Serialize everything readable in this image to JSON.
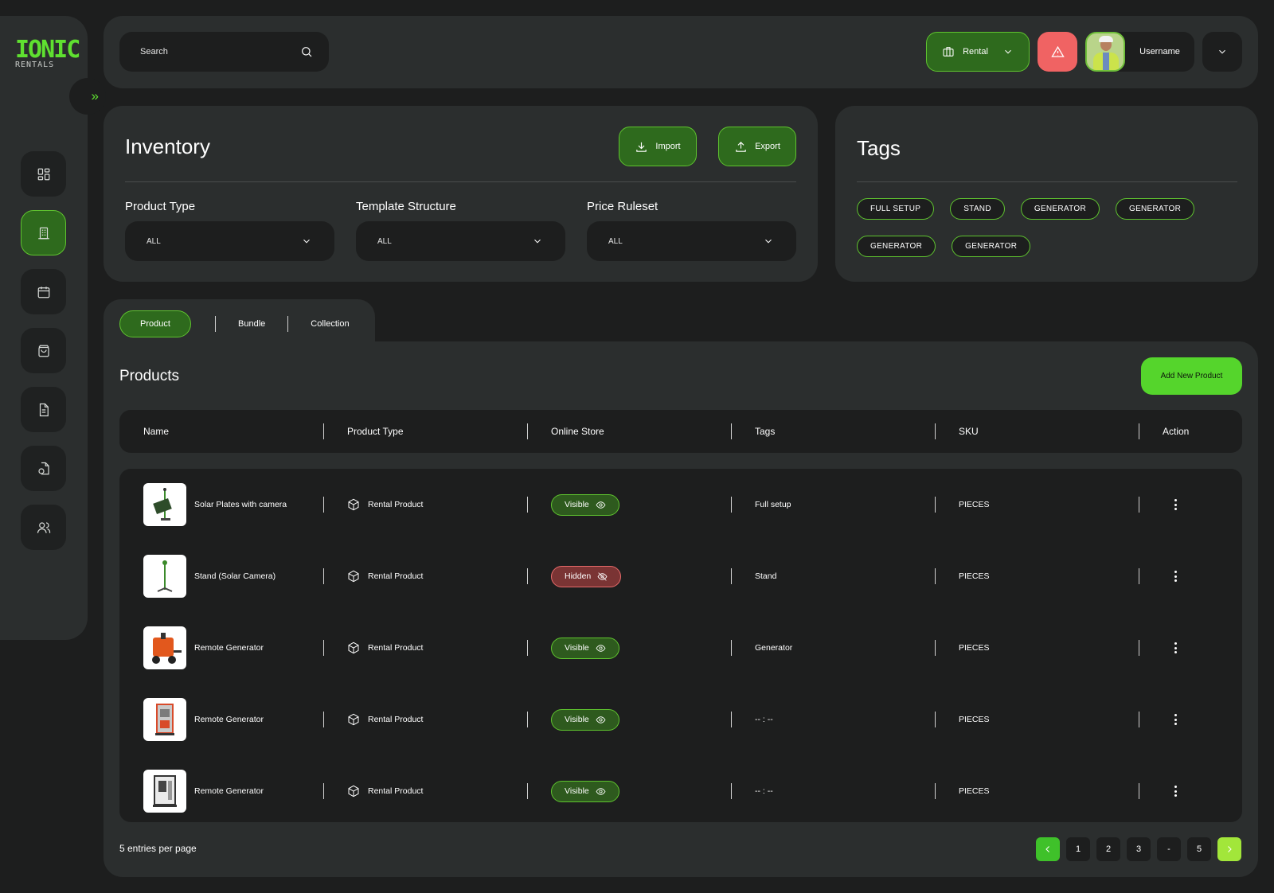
{
  "brand": {
    "logo_line1": "IONIC",
    "logo_line2": "RENTALS"
  },
  "colors": {
    "accent": "#5fc42f",
    "accent_bright": "#55d52c",
    "danger": "#f06363",
    "panel": "#2b2e2e",
    "background": "#1d1e1e"
  },
  "sidebar": {
    "toggle_icon": "double-chevron-right-icon",
    "items": [
      {
        "icon": "dashboard-grid-icon",
        "active": false
      },
      {
        "icon": "inventory-building-icon",
        "active": true
      },
      {
        "icon": "calendar-icon",
        "active": false
      },
      {
        "icon": "shopping-bag-icon",
        "active": false
      },
      {
        "icon": "document-icon",
        "active": false
      },
      {
        "icon": "file-settings-icon",
        "active": false
      },
      {
        "icon": "users-icon",
        "active": false
      }
    ]
  },
  "topbar": {
    "search": {
      "placeholder": "Search",
      "value": ""
    },
    "mode_label": "Rental",
    "username": "Username"
  },
  "inventory": {
    "title": "Inventory",
    "import_label": "Import",
    "export_label": "Export",
    "filters": [
      {
        "label": "Product Type",
        "value": "ALL"
      },
      {
        "label": "Template Structure",
        "value": "ALL"
      },
      {
        "label": "Price Ruleset",
        "value": "ALL"
      }
    ]
  },
  "tags_panel": {
    "title": "Tags",
    "tags": [
      "FULL SETUP",
      "STAND",
      "GENERATOR",
      "GENERATOR",
      "GENERATOR",
      "GENERATOR"
    ]
  },
  "tabs": [
    {
      "label": "Product",
      "active": true
    },
    {
      "label": "Bundle",
      "active": false
    },
    {
      "label": "Collection",
      "active": false
    }
  ],
  "products": {
    "title": "Products",
    "add_label": "Add New Product",
    "columns": [
      "Name",
      "Product Type",
      "Online Store",
      "Tags",
      "SKU",
      "Action"
    ],
    "rows": [
      {
        "name": "Solar Plates with camera",
        "type": "Rental Product",
        "status": "Visible",
        "tags": "Full setup",
        "sku": "PIECES",
        "image": "solar-plates-image"
      },
      {
        "name": "Stand (Solar Camera)",
        "type": "Rental Product",
        "status": "Hidden",
        "tags": "Stand",
        "sku": "PIECES",
        "image": "stand-image"
      },
      {
        "name": "Remote Generator",
        "type": "Rental Product",
        "status": "Visible",
        "tags": "Generator",
        "sku": "PIECES",
        "image": "orange-generator-image"
      },
      {
        "name": "Remote Generator",
        "type": "Rental Product",
        "status": "Visible",
        "tags": "-- : --",
        "sku": "PIECES",
        "image": "red-tower-generator-image"
      },
      {
        "name": "Remote Generator",
        "type": "Rental Product",
        "status": "Visible",
        "tags": "-- : --",
        "sku": "PIECES",
        "image": "panel-generator-image"
      }
    ],
    "per_page_label": "5 entries per page",
    "pagination": [
      "1",
      "2",
      "3",
      "-",
      "5"
    ]
  }
}
